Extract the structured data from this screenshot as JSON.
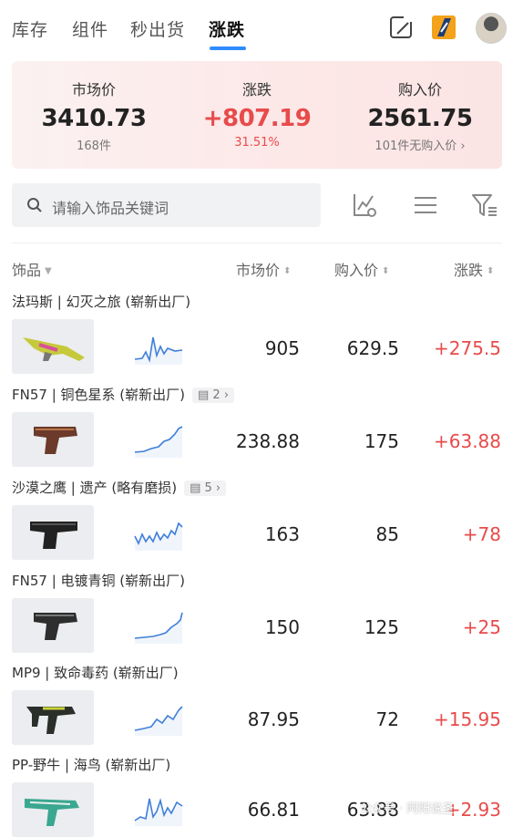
{
  "tabs": [
    "库存",
    "组件",
    "秒出货",
    "涨跌"
  ],
  "summary": {
    "market": {
      "label": "市场价",
      "value": "3410.73",
      "sub": "168件"
    },
    "change": {
      "label": "涨跌",
      "value": "+807.19",
      "sub": "31.51%"
    },
    "buy": {
      "label": "购入价",
      "value": "2561.75",
      "sub": "101件无购入价 ›"
    }
  },
  "search": {
    "placeholder": "请输入饰品关键词"
  },
  "table_header": {
    "item": "饰品",
    "market": "市场价",
    "buy": "购入价",
    "change": "涨跌"
  },
  "items": [
    {
      "name": "法玛斯 | 幻灭之旅 (崭新出厂)",
      "badge": "",
      "market": "905",
      "buy": "629.5",
      "change": "+275.5"
    },
    {
      "name": "FN57 | 铜色星系 (崭新出厂)",
      "badge": "2",
      "market": "238.88",
      "buy": "175",
      "change": "+63.88"
    },
    {
      "name": "沙漠之鹰 | 遗产 (略有磨损)",
      "badge": "5",
      "market": "163",
      "buy": "85",
      "change": "+78"
    },
    {
      "name": "FN57 | 电镀青铜 (崭新出厂)",
      "badge": "",
      "market": "150",
      "buy": "125",
      "change": "+25"
    },
    {
      "name": "MP9 | 致命毒药 (崭新出厂)",
      "badge": "",
      "market": "87.95",
      "buy": "72",
      "change": "+15.95"
    },
    {
      "name": "PP-野牛 | 海鸟 (崭新出厂)",
      "badge": "",
      "market": "66.81",
      "buy": "63.88",
      "change": "+2.93"
    }
  ],
  "watermark": "公众号 · 阿阳说圣",
  "colors": {
    "accent": "#2f8cff",
    "up": "#e84b4b"
  }
}
